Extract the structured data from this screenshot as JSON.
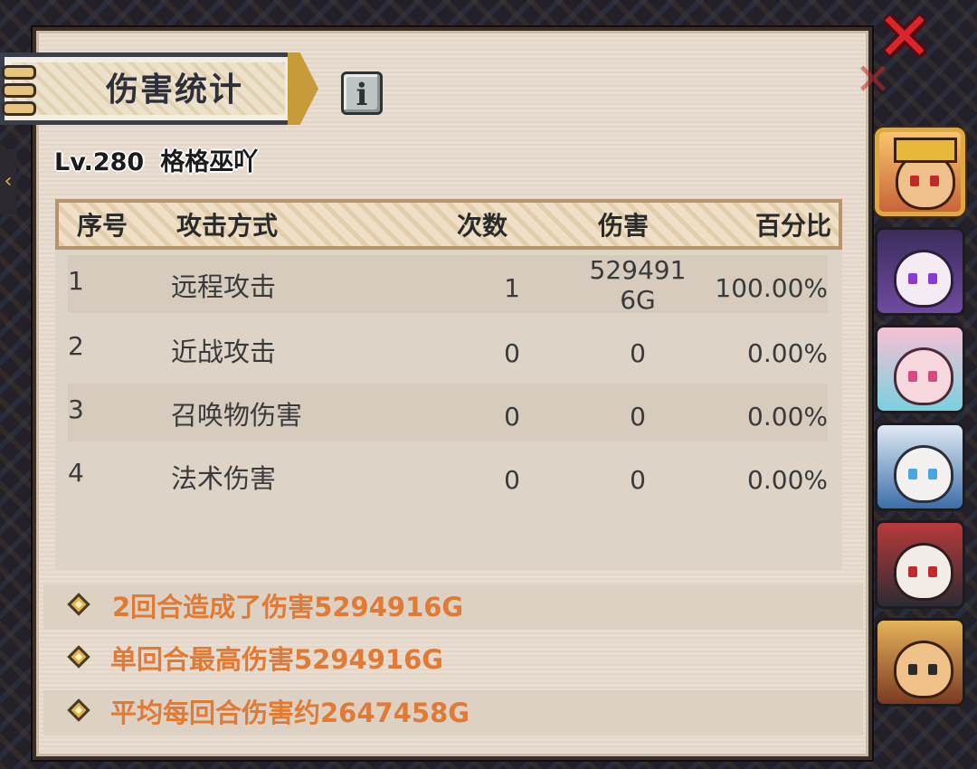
{
  "window": {
    "title": "伤害统计",
    "info_glyph": "i",
    "close_glyph": "✕"
  },
  "player": {
    "level": "Lv.280",
    "name": "格格巫吖"
  },
  "table": {
    "headers": [
      "序号",
      "攻击方式",
      "次数",
      "伤害",
      "百分比"
    ],
    "rows": [
      {
        "index": "1",
        "type": "远程攻击",
        "count": "1",
        "damage": "5294916G",
        "percent": "100.00%"
      },
      {
        "index": "2",
        "type": "近战攻击",
        "count": "0",
        "damage": "0",
        "percent": "0.00%"
      },
      {
        "index": "3",
        "type": "召唤物伤害",
        "count": "0",
        "damage": "0",
        "percent": "0.00%"
      },
      {
        "index": "4",
        "type": "法术伤害",
        "count": "0",
        "damage": "0",
        "percent": "0.00%"
      }
    ]
  },
  "summary": [
    "2回合造成了伤害5294916G",
    "单回合最高伤害5294916G",
    "平均每回合伤害约2647458G"
  ],
  "sidebar": {
    "heroes": [
      {
        "id": "hero-1",
        "selected": true,
        "color": "#e8a24a"
      },
      {
        "id": "hero-2",
        "selected": false,
        "color": "#b58ad6"
      },
      {
        "id": "hero-3",
        "selected": false,
        "color": "#f1a7c2"
      },
      {
        "id": "hero-4",
        "selected": false,
        "color": "#cfe1f2"
      },
      {
        "id": "hero-5",
        "selected": false,
        "color": "#e04a3a"
      },
      {
        "id": "hero-6",
        "selected": false,
        "color": "#d9a24a"
      }
    ]
  },
  "colors": {
    "accent_orange": "#e07a34",
    "close_red": "#d8262d",
    "panel_bg": "#e8ddd0",
    "selected_border": "#e2a840"
  }
}
